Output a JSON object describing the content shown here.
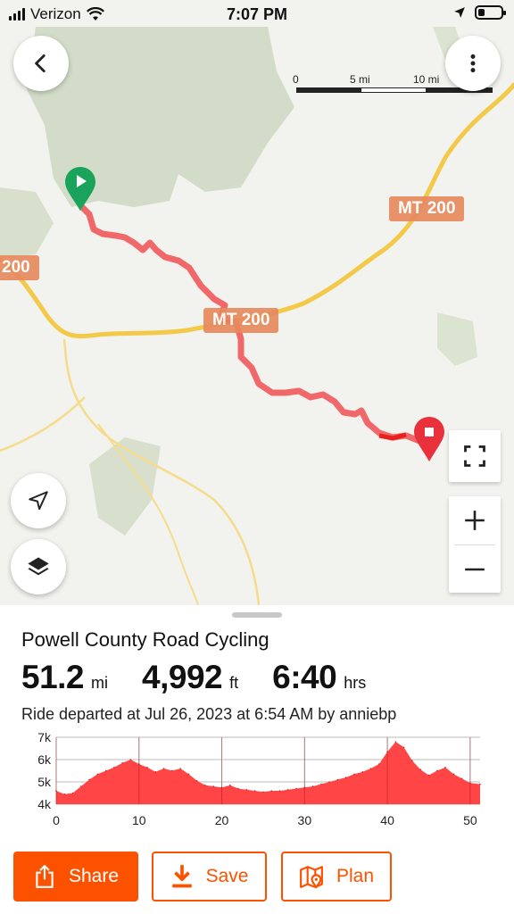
{
  "status_bar": {
    "carrier": "Verizon",
    "time": "7:07 PM",
    "battery_level": 0.3
  },
  "map": {
    "scale": {
      "labels": [
        "0",
        "5 mi",
        "10 mi",
        "mi"
      ]
    },
    "road_labels": [
      "MT 200",
      "MT 200",
      "200"
    ],
    "icons": {
      "back": "chevron-left-icon",
      "more": "more-vertical-icon",
      "locate": "navigation-arrow-icon",
      "layers": "layers-icon",
      "fullscreen": "fullscreen-icon",
      "zoom_in": "plus-icon",
      "zoom_out": "minus-icon",
      "start": "start-pin-icon",
      "end": "end-pin-icon"
    }
  },
  "activity": {
    "title": "Powell County Road Cycling",
    "distance": {
      "value": "51.2",
      "unit": "mi"
    },
    "elevation": {
      "value": "4,992",
      "unit": "ft"
    },
    "duration": {
      "value": "6:40",
      "unit": "hrs"
    },
    "departed": "Ride departed at Jul 26, 2023 at 6:54 AM by anniebp"
  },
  "chart_data": {
    "type": "area",
    "x_label": "",
    "y_label": "",
    "x_ticks": [
      0,
      10,
      20,
      30,
      40,
      50
    ],
    "x_tick_labels": [
      "0",
      "10",
      "20",
      "30",
      "40",
      "50"
    ],
    "y_ticks": [
      4000,
      5000,
      6000,
      7000
    ],
    "y_tick_labels": [
      "4k",
      "5k",
      "6k",
      "7k"
    ],
    "xlim": [
      0,
      51.2
    ],
    "ylim": [
      4000,
      7000
    ],
    "grid": true,
    "fill_color": "#ff3b3b",
    "series": [
      {
        "x": [
          0,
          1,
          2,
          3,
          4,
          5,
          6,
          7,
          8,
          9,
          10,
          11,
          12,
          13,
          14,
          15,
          16,
          17,
          18,
          19,
          20,
          21,
          22,
          23,
          24,
          25,
          26,
          27,
          28,
          29,
          30,
          31,
          32,
          33,
          34,
          35,
          36,
          37,
          38,
          39,
          40,
          41,
          42,
          43,
          44,
          45,
          46,
          47,
          48,
          49,
          50,
          51.2
        ],
        "y": [
          4600,
          4450,
          4500,
          4800,
          5100,
          5350,
          5500,
          5650,
          5850,
          6000,
          5800,
          5650,
          5450,
          5600,
          5500,
          5600,
          5350,
          5050,
          4850,
          4800,
          4750,
          4850,
          4700,
          4650,
          4600,
          4550,
          4600,
          4600,
          4650,
          4700,
          4750,
          4800,
          4900,
          5000,
          5100,
          5200,
          5350,
          5450,
          5600,
          5800,
          6350,
          6800,
          6550,
          5950,
          5550,
          5300,
          5500,
          5650,
          5350,
          5150,
          4950,
          4900
        ]
      }
    ]
  },
  "actions": {
    "share": "Share",
    "save": "Save",
    "plan": "Plan"
  },
  "colors": {
    "brand": "#fc5200",
    "route": "#f0686a",
    "route_dark": "#e8201f",
    "start_pin": "#1aa35a",
    "end_pin": "#e8313a",
    "highway": "#f3c94a"
  }
}
